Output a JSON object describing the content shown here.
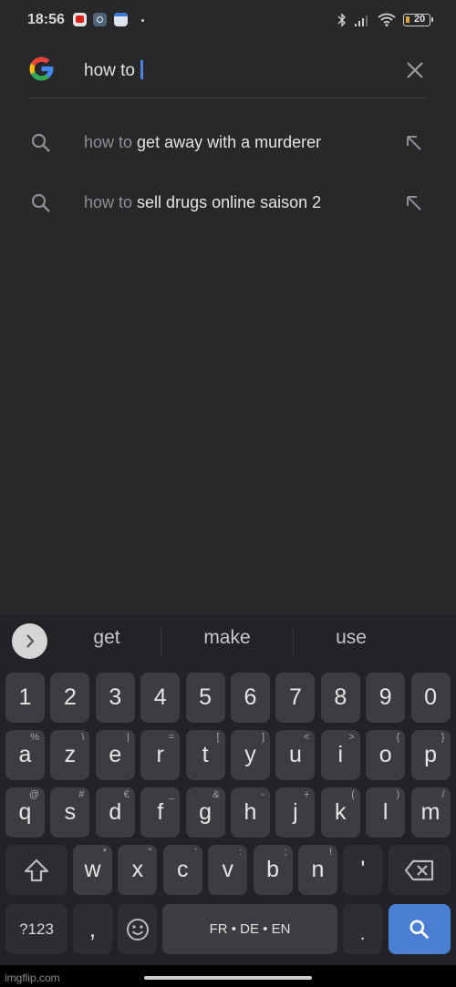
{
  "status_bar": {
    "time": "18:56",
    "notification_icons": [
      "youtube-icon",
      "settings-icon",
      "calendar-icon",
      "more-dot-icon"
    ],
    "right_icons": [
      "bluetooth-icon",
      "signal-icon",
      "wifi-icon",
      "battery-icon"
    ],
    "battery_level": "20"
  },
  "search": {
    "query": "how to ",
    "logo": "google-g-icon",
    "clear_icon": "close-icon"
  },
  "suggestions": [
    {
      "prefix": "how to",
      "completion": " get away with a murderer",
      "icon": "search-icon",
      "action_icon": "arrow-up-left-icon"
    },
    {
      "prefix": "how to",
      "completion": " sell drugs online saison 2",
      "icon": "search-icon",
      "action_icon": "arrow-up-left-icon"
    }
  ],
  "keyboard": {
    "word_suggestions": [
      "get",
      "make",
      "use"
    ],
    "number_row": [
      "1",
      "2",
      "3",
      "4",
      "5",
      "6",
      "7",
      "8",
      "9",
      "0"
    ],
    "row1": [
      {
        "k": "a",
        "h": "%"
      },
      {
        "k": "z",
        "h": "\\"
      },
      {
        "k": "e",
        "h": "|"
      },
      {
        "k": "r",
        "h": "="
      },
      {
        "k": "t",
        "h": "["
      },
      {
        "k": "y",
        "h": "]"
      },
      {
        "k": "u",
        "h": "<"
      },
      {
        "k": "i",
        "h": ">"
      },
      {
        "k": "o",
        "h": "{"
      },
      {
        "k": "p",
        "h": "}"
      }
    ],
    "row2": [
      {
        "k": "q",
        "h": "@"
      },
      {
        "k": "s",
        "h": "#"
      },
      {
        "k": "d",
        "h": "€"
      },
      {
        "k": "f",
        "h": "_"
      },
      {
        "k": "g",
        "h": "&"
      },
      {
        "k": "h",
        "h": "-"
      },
      {
        "k": "j",
        "h": "+"
      },
      {
        "k": "k",
        "h": "("
      },
      {
        "k": "l",
        "h": ")"
      },
      {
        "k": "m",
        "h": "/"
      }
    ],
    "row3": [
      {
        "k": "w",
        "h": "*"
      },
      {
        "k": "x",
        "h": "\""
      },
      {
        "k": "c",
        "h": "'"
      },
      {
        "k": "v",
        "h": ":"
      },
      {
        "k": "b",
        "h": ";"
      },
      {
        "k": "n",
        "h": "!"
      },
      {
        "k": "'",
        "h": ""
      }
    ],
    "symbols_label": "?123",
    "comma_label": ",",
    "space_label": "FR • DE • EN",
    "period_label": ".",
    "accent_color": "#4a7fd4"
  },
  "footer": {
    "watermark": "imgflip.com"
  }
}
